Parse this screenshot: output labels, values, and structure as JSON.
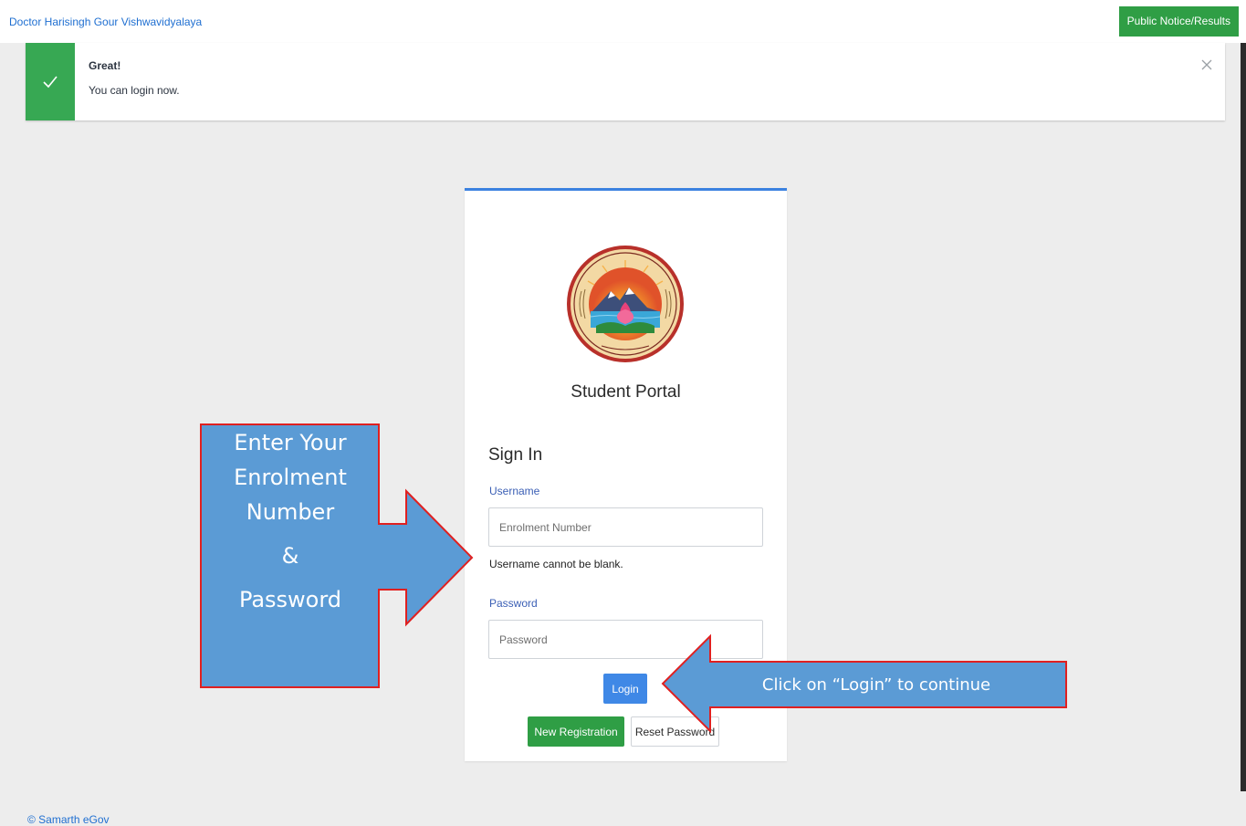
{
  "header": {
    "brand": "Doctor Harisingh Gour Vishwavidyalaya",
    "notice_button": "Public Notice/Results"
  },
  "alert": {
    "title": "Great!",
    "message": "You can login now.",
    "icons": {
      "status": "check-icon",
      "dismiss": "close-icon"
    },
    "color": "#37a853"
  },
  "login": {
    "portal_name": "Student Portal",
    "heading": "Sign In",
    "username_label": "Username",
    "username_placeholder": "Enrolment Number",
    "username_value": "",
    "username_error": "Username cannot be blank.",
    "password_label": "Password",
    "password_placeholder": "Password",
    "password_value": "",
    "login_button": "Login",
    "register_button": "New Registration",
    "reset_button": "Reset Password"
  },
  "annotations": {
    "enter_credentials": {
      "line1": "Enter Your",
      "line2": "Enrolment",
      "line3": "Number",
      "line4": "&",
      "line5": "Password"
    },
    "login_hint": "Click on “Login” to continue"
  },
  "footer": {
    "text": "© Samarth eGov"
  },
  "colors": {
    "primary": "#3f88e6",
    "success": "#2f9e45",
    "callout_fill": "#5b9bd5",
    "callout_border": "#e02020"
  }
}
